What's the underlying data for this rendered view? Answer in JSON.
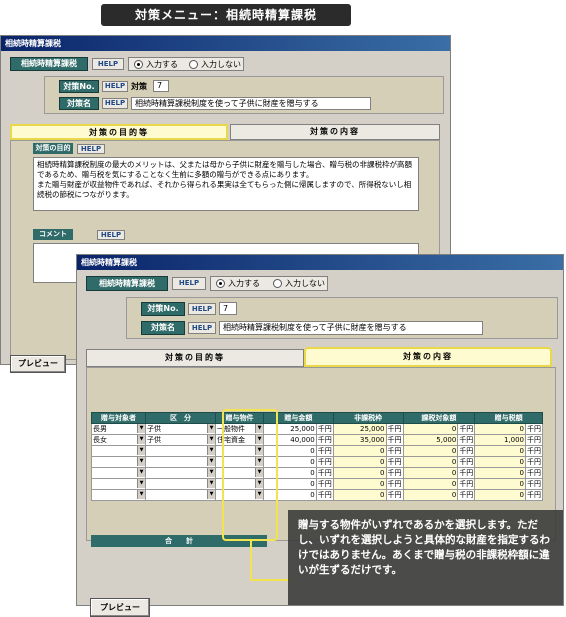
{
  "banner": {
    "title": "対策メニュー：相続時精算課税"
  },
  "back_window": {
    "title": "相続時精算課税",
    "section_button": "相続時精算課税",
    "help": "HELP",
    "radio_input": "入力する",
    "radio_no_input": "入力しない",
    "taisaku_no_label": "対策No.",
    "taisaku_label": "対策",
    "taisaku_no_value": "7",
    "taisaku_name_label": "対策名",
    "taisaku_name_value": "相続時精算課税制度を使って子供に財産を贈与する",
    "tab_purpose": "対策の目的等",
    "tab_content": "対策の内容",
    "purpose_label": "対策の目的",
    "purpose_text": "相続時精算課税制度の最大のメリットは、父または母から子供に財産を贈与した場合、贈与税の非課税枠が高額であるため、贈与税を気にすることなく生前に多額の贈与ができる点にあります。\nまた贈与財産が収益物件であれば、それから得られる果実は全てもらった側に帰属しますので、所得税ないし相続税の節税につながります。",
    "comment_label": "コメント",
    "preview_button": "プレビュー"
  },
  "front_window": {
    "title": "相続時精算課税",
    "section_button": "相続時精算課税",
    "help": "HELP",
    "radio_input": "入力する",
    "radio_no_input": "入力しない",
    "taisaku_no_label": "対策No.",
    "taisaku_no_value": "7",
    "taisaku_name_label": "対策名",
    "taisaku_name_value": "相続時精算課税制度を使って子供に財産を贈与する",
    "tab_purpose": "対策の目的等",
    "tab_content": "対策の内容",
    "table": {
      "headers": [
        "贈与対象者",
        "区　分",
        "贈与物件",
        "贈与金額",
        "非課税枠",
        "課税対象額",
        "贈与税額"
      ],
      "unit": "千円",
      "rows": [
        {
          "target": "長男",
          "kubun": "子供",
          "bukken": "一般物件",
          "amount": "25,000",
          "hikazei": "25,000",
          "kazei": "0",
          "zei": "0"
        },
        {
          "target": "長女",
          "kubun": "子供",
          "bukken": "住宅資金",
          "amount": "40,000",
          "hikazei": "35,000",
          "kazei": "5,000",
          "zei": "1,000"
        },
        {
          "target": "",
          "kubun": "",
          "bukken": "",
          "amount": "0",
          "hikazei": "0",
          "kazei": "0",
          "zei": "0"
        },
        {
          "target": "",
          "kubun": "",
          "bukken": "",
          "amount": "0",
          "hikazei": "0",
          "kazei": "0",
          "zei": "0"
        },
        {
          "target": "",
          "kubun": "",
          "bukken": "",
          "amount": "0",
          "hikazei": "0",
          "kazei": "0",
          "zei": "0"
        },
        {
          "target": "",
          "kubun": "",
          "bukken": "",
          "amount": "0",
          "hikazei": "0",
          "kazei": "0",
          "zei": "0"
        },
        {
          "target": "",
          "kubun": "",
          "bukken": "",
          "amount": "0",
          "hikazei": "0",
          "kazei": "0",
          "zei": "0"
        }
      ],
      "total_label": "合　　計"
    },
    "preview_button": "プレビュー"
  },
  "callout": {
    "text": "贈与する物件がいずれであるかを選択します。ただし、いずれを選択しようと具体的な財産を指定するわけではありません。あくまで贈与税の非課税枠額に違いが生ずるだけです。"
  }
}
